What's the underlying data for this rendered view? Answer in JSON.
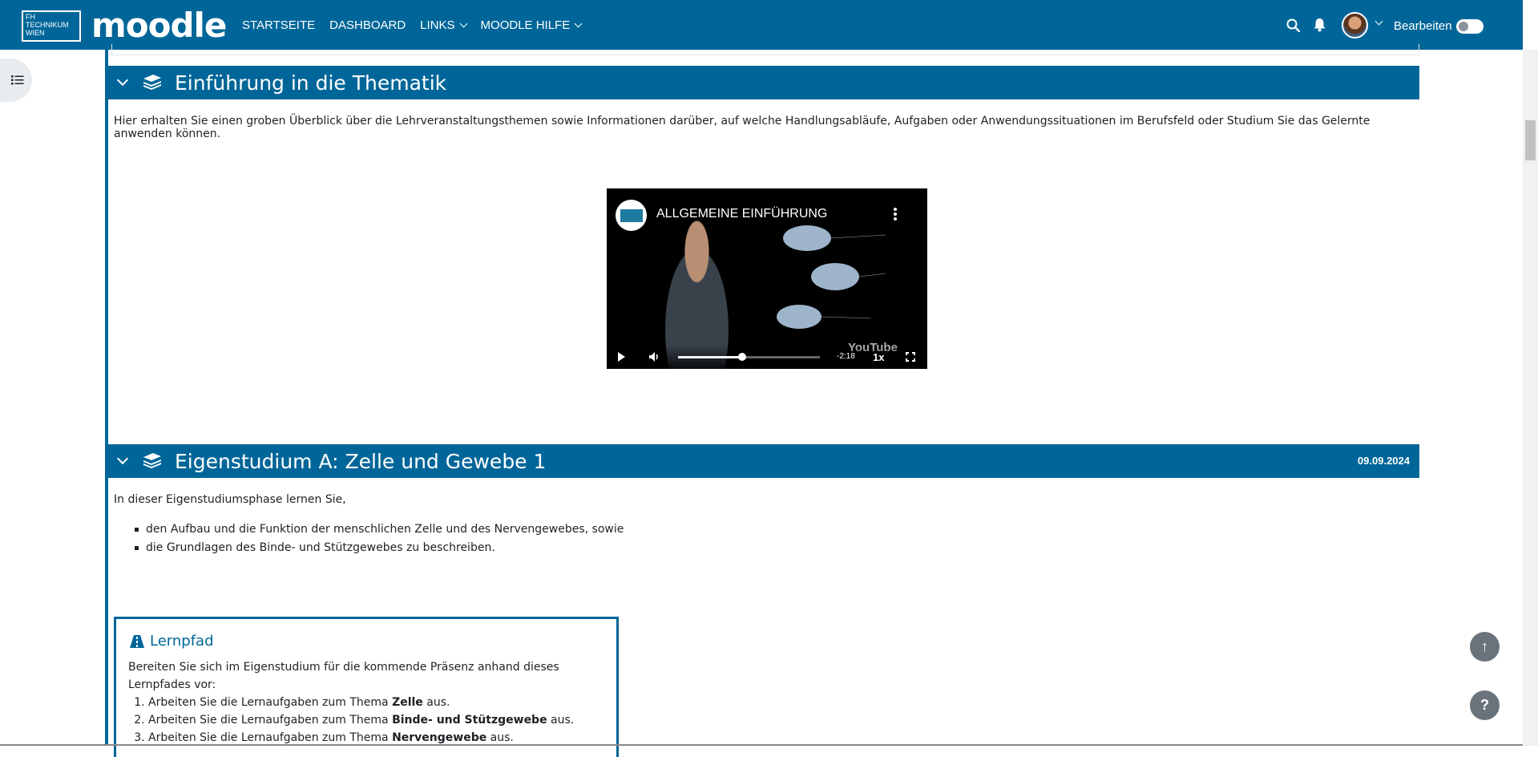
{
  "header": {
    "fh_logo_lines": [
      "FH",
      "TECHNIKUM",
      "WIEN"
    ],
    "moodle_logo": "moodle",
    "nav": [
      {
        "label": "STARTSEITE"
      },
      {
        "label": "DASHBOARD"
      },
      {
        "label": "LINKS"
      },
      {
        "label": "MOODLE HILFE"
      }
    ],
    "edit_label": "Bearbeiten",
    "edit_toggle_on": false
  },
  "sections": [
    {
      "title": "Einführung in die Thematik",
      "intro": "Hier erhalten Sie einen groben Überblick über die Lehrveranstaltungsthemen sowie Informationen darüber, auf welche Handlungsabläufe, Aufgaben oder Anwendungssituationen im Berufsfeld oder Studium Sie das Gelernte anwenden können.",
      "video": {
        "title": "ALLGEMEINE EINFÜHRUNG",
        "time": "-2:18",
        "speed": "1x",
        "watermark": "YouTube",
        "progress": 0.45
      }
    },
    {
      "title": "Eigenstudium A: Zelle und Gewebe 1",
      "date": "09.09.2024",
      "intro": "In dieser Eigenstudiumsphase lernen Sie,",
      "bullets": [
        "den Aufbau und die Funktion der menschlichen Zelle und des Nervengewebes, sowie",
        "die Grundlagen des Binde- und Stützgewebes zu beschreiben."
      ],
      "lernpfad": {
        "title": "Lernpfad",
        "text": "Bereiten Sie sich im Eigenstudium für die kommende Präsenz anhand dieses Lernpfades vor:",
        "steps": [
          {
            "prefix": "Arbeiten Sie die Lernaufgaben zum Thema ",
            "bold": "Zelle",
            "suffix": " aus."
          },
          {
            "prefix": "Arbeiten Sie die Lernaufgaben zum Thema ",
            "bold": "Binde- und Stützgewebe",
            "suffix": " aus."
          },
          {
            "prefix": "Arbeiten Sie die Lernaufgaben zum Thema ",
            "bold": "Nervengewebe",
            "suffix": " aus."
          }
        ]
      }
    }
  ],
  "fabs": {
    "up": "↑",
    "help": "?"
  },
  "colors": {
    "brand": "#006699"
  }
}
